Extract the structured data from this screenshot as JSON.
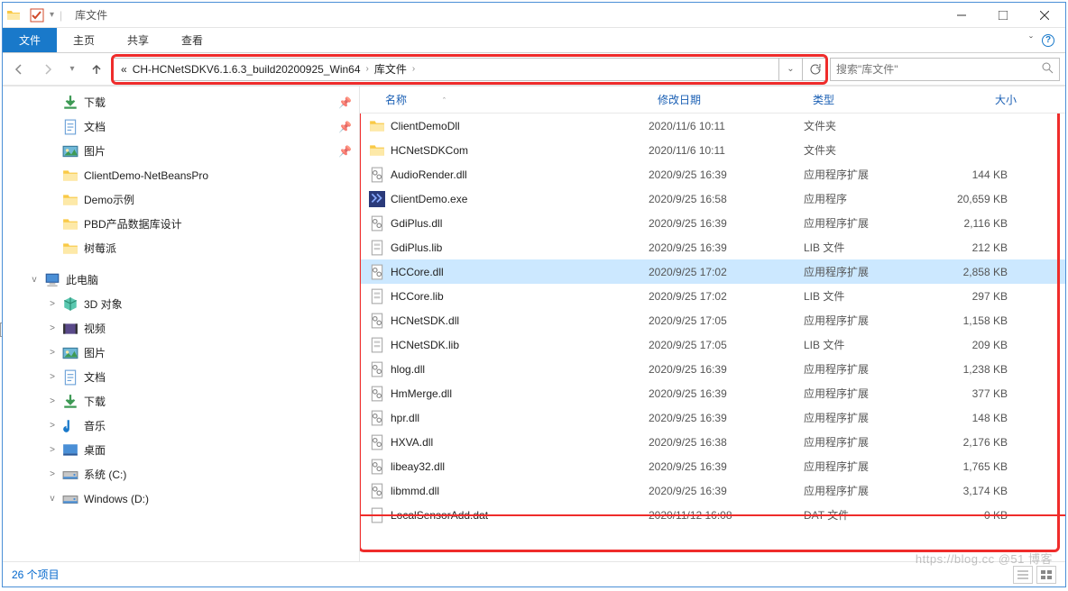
{
  "window": {
    "title": "库文件",
    "tabs": {
      "file": "文件",
      "home": "主页",
      "share": "共享",
      "view": "查看"
    }
  },
  "address": {
    "prefix": "«",
    "crumb1": "CH-HCNetSDKV6.1.6.3_build20200925_Win64",
    "crumb2": "库文件"
  },
  "search": {
    "placeholder": "搜索\"库文件\""
  },
  "sidebar": {
    "items": [
      {
        "label": "下载",
        "icon": "download",
        "indent": 50,
        "pin": true
      },
      {
        "label": "文档",
        "icon": "doc",
        "indent": 50,
        "pin": true
      },
      {
        "label": "图片",
        "icon": "picture",
        "indent": 50,
        "pin": true
      },
      {
        "label": "ClientDemo-NetBeansPro",
        "icon": "folder",
        "indent": 50,
        "pin": false
      },
      {
        "label": "Demo示例",
        "icon": "folder",
        "indent": 50,
        "pin": false
      },
      {
        "label": "PBD产品数据库设计",
        "icon": "folder",
        "indent": 50,
        "pin": false
      },
      {
        "label": "树莓派",
        "icon": "folder",
        "indent": 50,
        "pin": false
      },
      {
        "_spacer": true
      },
      {
        "label": "此电脑",
        "icon": "pc",
        "indent": 30,
        "exp": "v",
        "bold": false
      },
      {
        "label": "3D 对象",
        "icon": "cube",
        "indent": 50,
        "exp": ">"
      },
      {
        "label": "视频",
        "icon": "video",
        "indent": 50,
        "exp": ">"
      },
      {
        "label": "图片",
        "icon": "picture",
        "indent": 50,
        "exp": ">"
      },
      {
        "label": "文档",
        "icon": "doc",
        "indent": 50,
        "exp": ">"
      },
      {
        "label": "下载",
        "icon": "download",
        "indent": 50,
        "exp": ">"
      },
      {
        "label": "音乐",
        "icon": "music",
        "indent": 50,
        "exp": ">"
      },
      {
        "label": "桌面",
        "icon": "desktop",
        "indent": 50,
        "exp": ">"
      },
      {
        "label": "系统 (C:)",
        "icon": "drive",
        "indent": 50,
        "exp": ">"
      },
      {
        "label": "Windows (D:)",
        "icon": "drive",
        "indent": 50,
        "exp": "v"
      }
    ]
  },
  "columns": {
    "name": "名称",
    "date": "修改日期",
    "type": "类型",
    "size": "大小"
  },
  "files": [
    {
      "icon": "folder",
      "name": "ClientDemoDll",
      "date": "2020/11/6 10:11",
      "type": "文件夹",
      "size": ""
    },
    {
      "icon": "folder",
      "name": "HCNetSDKCom",
      "date": "2020/11/6 10:11",
      "type": "文件夹",
      "size": ""
    },
    {
      "icon": "dll",
      "name": "AudioRender.dll",
      "date": "2020/9/25 16:39",
      "type": "应用程序扩展",
      "size": "144 KB"
    },
    {
      "icon": "exe",
      "name": "ClientDemo.exe",
      "date": "2020/9/25 16:58",
      "type": "应用程序",
      "size": "20,659 KB"
    },
    {
      "icon": "dll",
      "name": "GdiPlus.dll",
      "date": "2020/9/25 16:39",
      "type": "应用程序扩展",
      "size": "2,116 KB"
    },
    {
      "icon": "lib",
      "name": "GdiPlus.lib",
      "date": "2020/9/25 16:39",
      "type": "LIB 文件",
      "size": "212 KB"
    },
    {
      "icon": "dll",
      "name": "HCCore.dll",
      "date": "2020/9/25 17:02",
      "type": "应用程序扩展",
      "size": "2,858 KB",
      "sel": true
    },
    {
      "icon": "lib",
      "name": "HCCore.lib",
      "date": "2020/9/25 17:02",
      "type": "LIB 文件",
      "size": "297 KB"
    },
    {
      "icon": "dll",
      "name": "HCNetSDK.dll",
      "date": "2020/9/25 17:05",
      "type": "应用程序扩展",
      "size": "1,158 KB"
    },
    {
      "icon": "lib",
      "name": "HCNetSDK.lib",
      "date": "2020/9/25 17:05",
      "type": "LIB 文件",
      "size": "209 KB"
    },
    {
      "icon": "dll",
      "name": "hlog.dll",
      "date": "2020/9/25 16:39",
      "type": "应用程序扩展",
      "size": "1,238 KB"
    },
    {
      "icon": "dll",
      "name": "HmMerge.dll",
      "date": "2020/9/25 16:39",
      "type": "应用程序扩展",
      "size": "377 KB"
    },
    {
      "icon": "dll",
      "name": "hpr.dll",
      "date": "2020/9/25 16:39",
      "type": "应用程序扩展",
      "size": "148 KB"
    },
    {
      "icon": "dll",
      "name": "HXVA.dll",
      "date": "2020/9/25 16:38",
      "type": "应用程序扩展",
      "size": "2,176 KB"
    },
    {
      "icon": "dll",
      "name": "libeay32.dll",
      "date": "2020/9/25 16:39",
      "type": "应用程序扩展",
      "size": "1,765 KB"
    },
    {
      "icon": "dll",
      "name": "libmmd.dll",
      "date": "2020/9/25 16:39",
      "type": "应用程序扩展",
      "size": "3,174 KB"
    },
    {
      "icon": "dat",
      "name": "LocalSensorAdd.dat",
      "date": "2020/11/12 16:08",
      "type": "DAT 文件",
      "size": "0 KB",
      "cut": true
    }
  ],
  "status": {
    "count": "26 个项目"
  },
  "watermark": "https://blog.cc   @51   博客"
}
